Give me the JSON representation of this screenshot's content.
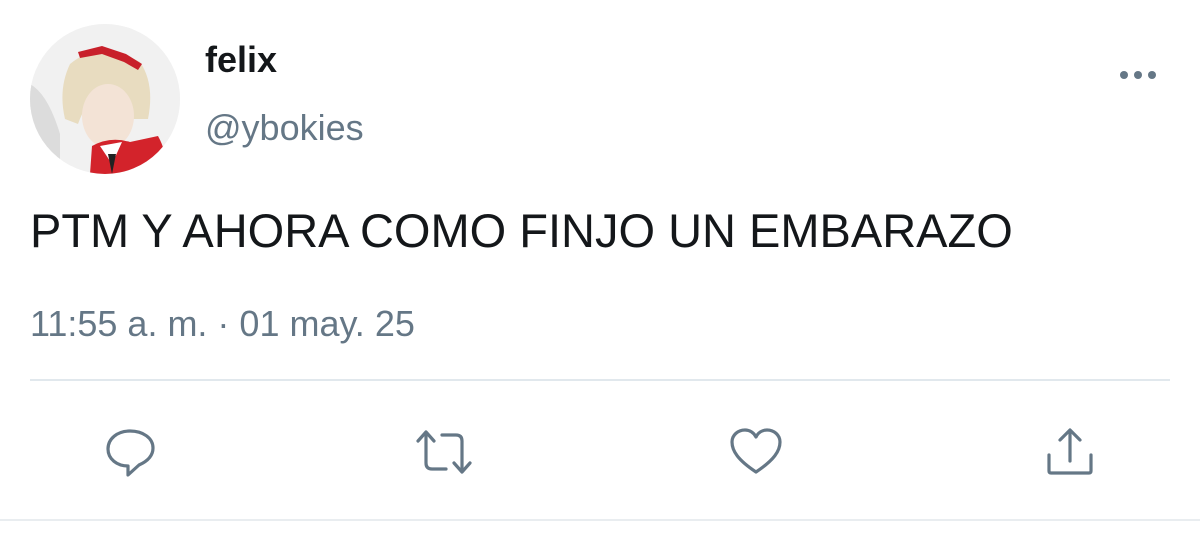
{
  "tweet": {
    "author": {
      "display_name": "felix",
      "handle": "@ybokies"
    },
    "text": "PTM Y AHORA COMO FINJO UN EMBARAZO",
    "timestamp": "11:55 a. m. · 01 may. 25"
  },
  "icons": {
    "more": "more-horizontal-icon",
    "reply": "reply-icon",
    "retweet": "retweet-icon",
    "like": "heart-icon",
    "share": "share-icon"
  },
  "colors": {
    "text_primary": "#14171a",
    "text_secondary": "#657786",
    "divider": "#e1e8ed"
  }
}
